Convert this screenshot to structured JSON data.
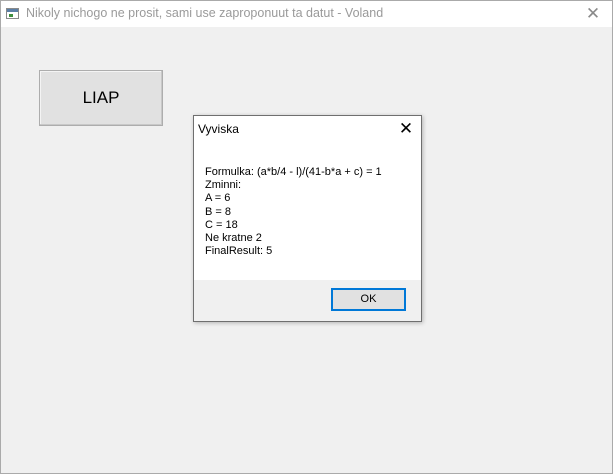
{
  "window": {
    "title": "Nikoly nichogo ne prosit, sami use zaproponuut ta datut - Voland",
    "close_glyph": "✕"
  },
  "main": {
    "liap_button_label": "LIAP"
  },
  "dialog": {
    "title": "Vyviska",
    "close_glyph": "✕",
    "lines": [
      "Formulka: (a*b/4 - l)/(41-b*a + c) = 1",
      "Zminni:",
      "A = 6",
      "B = 8",
      "C = 18",
      "Ne kratne 2",
      "FinalResult: 5"
    ],
    "ok_label": "OK"
  }
}
